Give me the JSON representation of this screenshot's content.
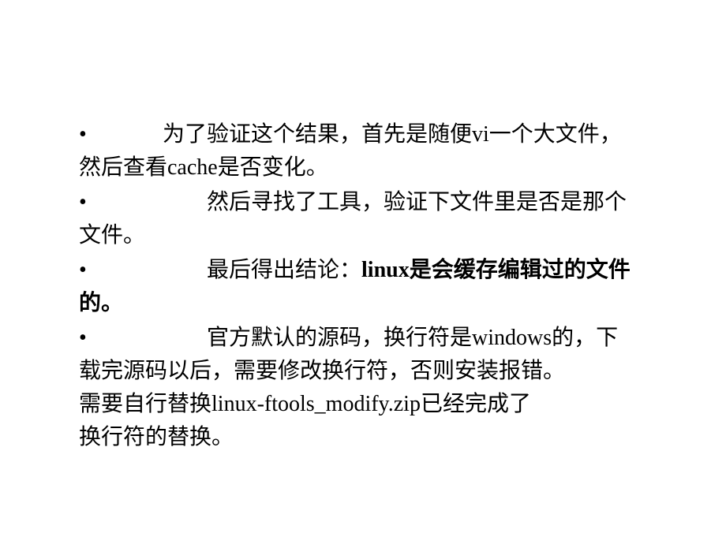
{
  "bullets": [
    {
      "prefix_indent": "  ",
      "line1_a": "为了验证这个结果，首先是随便",
      "line1_b": "vi",
      "line1_c": "一个大文件，",
      "line2": "然后查看cache是否变化。"
    },
    {
      "prefix_indent": "        ",
      "line1": "然后寻找了工具，验证下文件里是否是那个",
      "line2": "文件。"
    },
    {
      "prefix_indent": "        ",
      "line1_a": "最后得出结论：",
      "line1_b": "linux是会缓存编辑过的文件",
      "line2": "的。"
    },
    {
      "prefix_indent": "        ",
      "line1": "官方默认的源码，换行符是windows的，下",
      "line2": "载完源码以后，需要修改换行符，否则安装报错。",
      "line3_a": "需要自行替换",
      "line3_b": "linux-ftools_modify.zip",
      "line3_c": "已经完成了",
      "line4": "换行符的替换。"
    }
  ]
}
